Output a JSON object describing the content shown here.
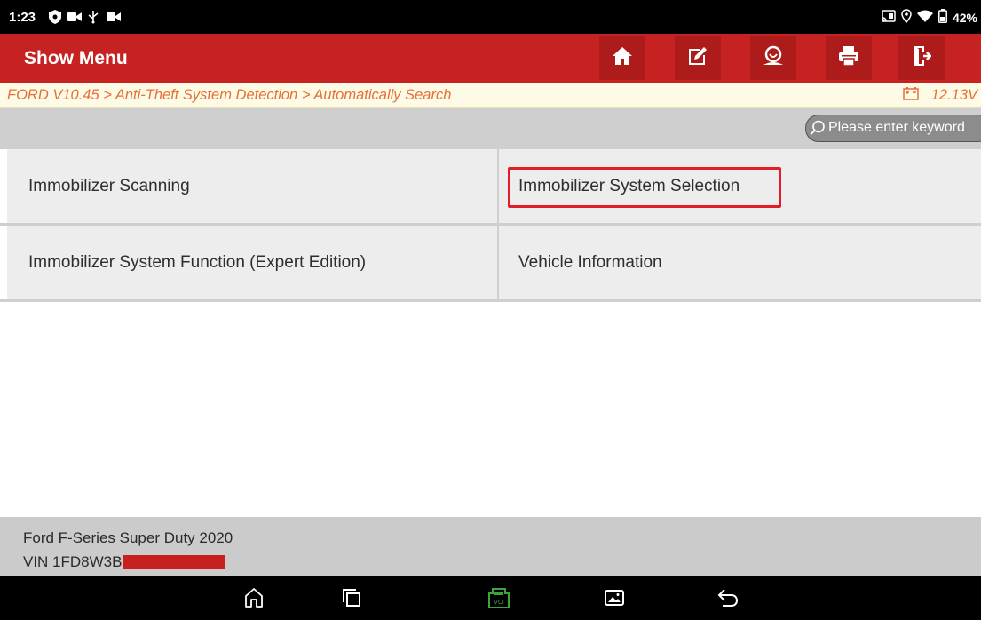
{
  "status_bar": {
    "time": "1:23",
    "left_icons": [
      "shield-icon",
      "video-icon",
      "usb-icon",
      "video-icon"
    ],
    "battery_percent": "42%",
    "right_icons": [
      "cast-icon",
      "location-icon",
      "wifi-icon",
      "battery-icon"
    ]
  },
  "header": {
    "title": "Show Menu",
    "background": "#c62222",
    "toolbar": [
      "home-icon",
      "edit-icon",
      "support-icon",
      "print-icon",
      "exit-icon"
    ]
  },
  "breadcrumb": {
    "path": "FORD V10.45 > Anti-Theft System Detection > Automatically Search",
    "voltage": "12.13V",
    "color": "#e4703a"
  },
  "search": {
    "placeholder": "Please enter keyword"
  },
  "menu": {
    "items": [
      {
        "label": "Immobilizer Scanning"
      },
      {
        "label": "Immobilizer System Selection",
        "highlighted": true
      },
      {
        "label": "Immobilizer System Function (Expert Edition)"
      },
      {
        "label": "Vehicle Information"
      }
    ]
  },
  "footer": {
    "vehicle": "Ford F-Series Super Duty 2020",
    "vin": "VIN 1FD8W3B"
  },
  "navbar": {
    "buttons": [
      "home-icon",
      "recents-icon",
      "vci-icon",
      "gallery-icon",
      "back-icon"
    ],
    "vci_color": "#3ba53b"
  }
}
